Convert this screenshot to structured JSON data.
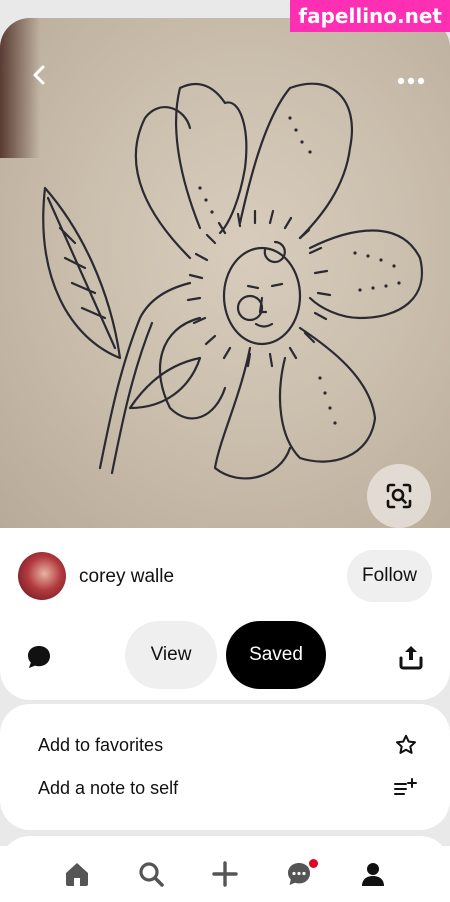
{
  "watermark": "fapellino.net",
  "pin": {
    "creator_name": "corey walle",
    "follow_label": "Follow",
    "view_label": "View",
    "saved_label": "Saved"
  },
  "actions": [
    {
      "label": "Add to favorites",
      "icon": "star-icon"
    },
    {
      "label": "Add a note to self",
      "icon": "note-add-icon"
    }
  ],
  "nav": [
    "home-icon",
    "search-icon",
    "plus-icon",
    "messages-icon",
    "profile-icon"
  ],
  "colors": {
    "accent": "#000000",
    "notification": "#e60023",
    "pill_gray": "#efefef"
  }
}
